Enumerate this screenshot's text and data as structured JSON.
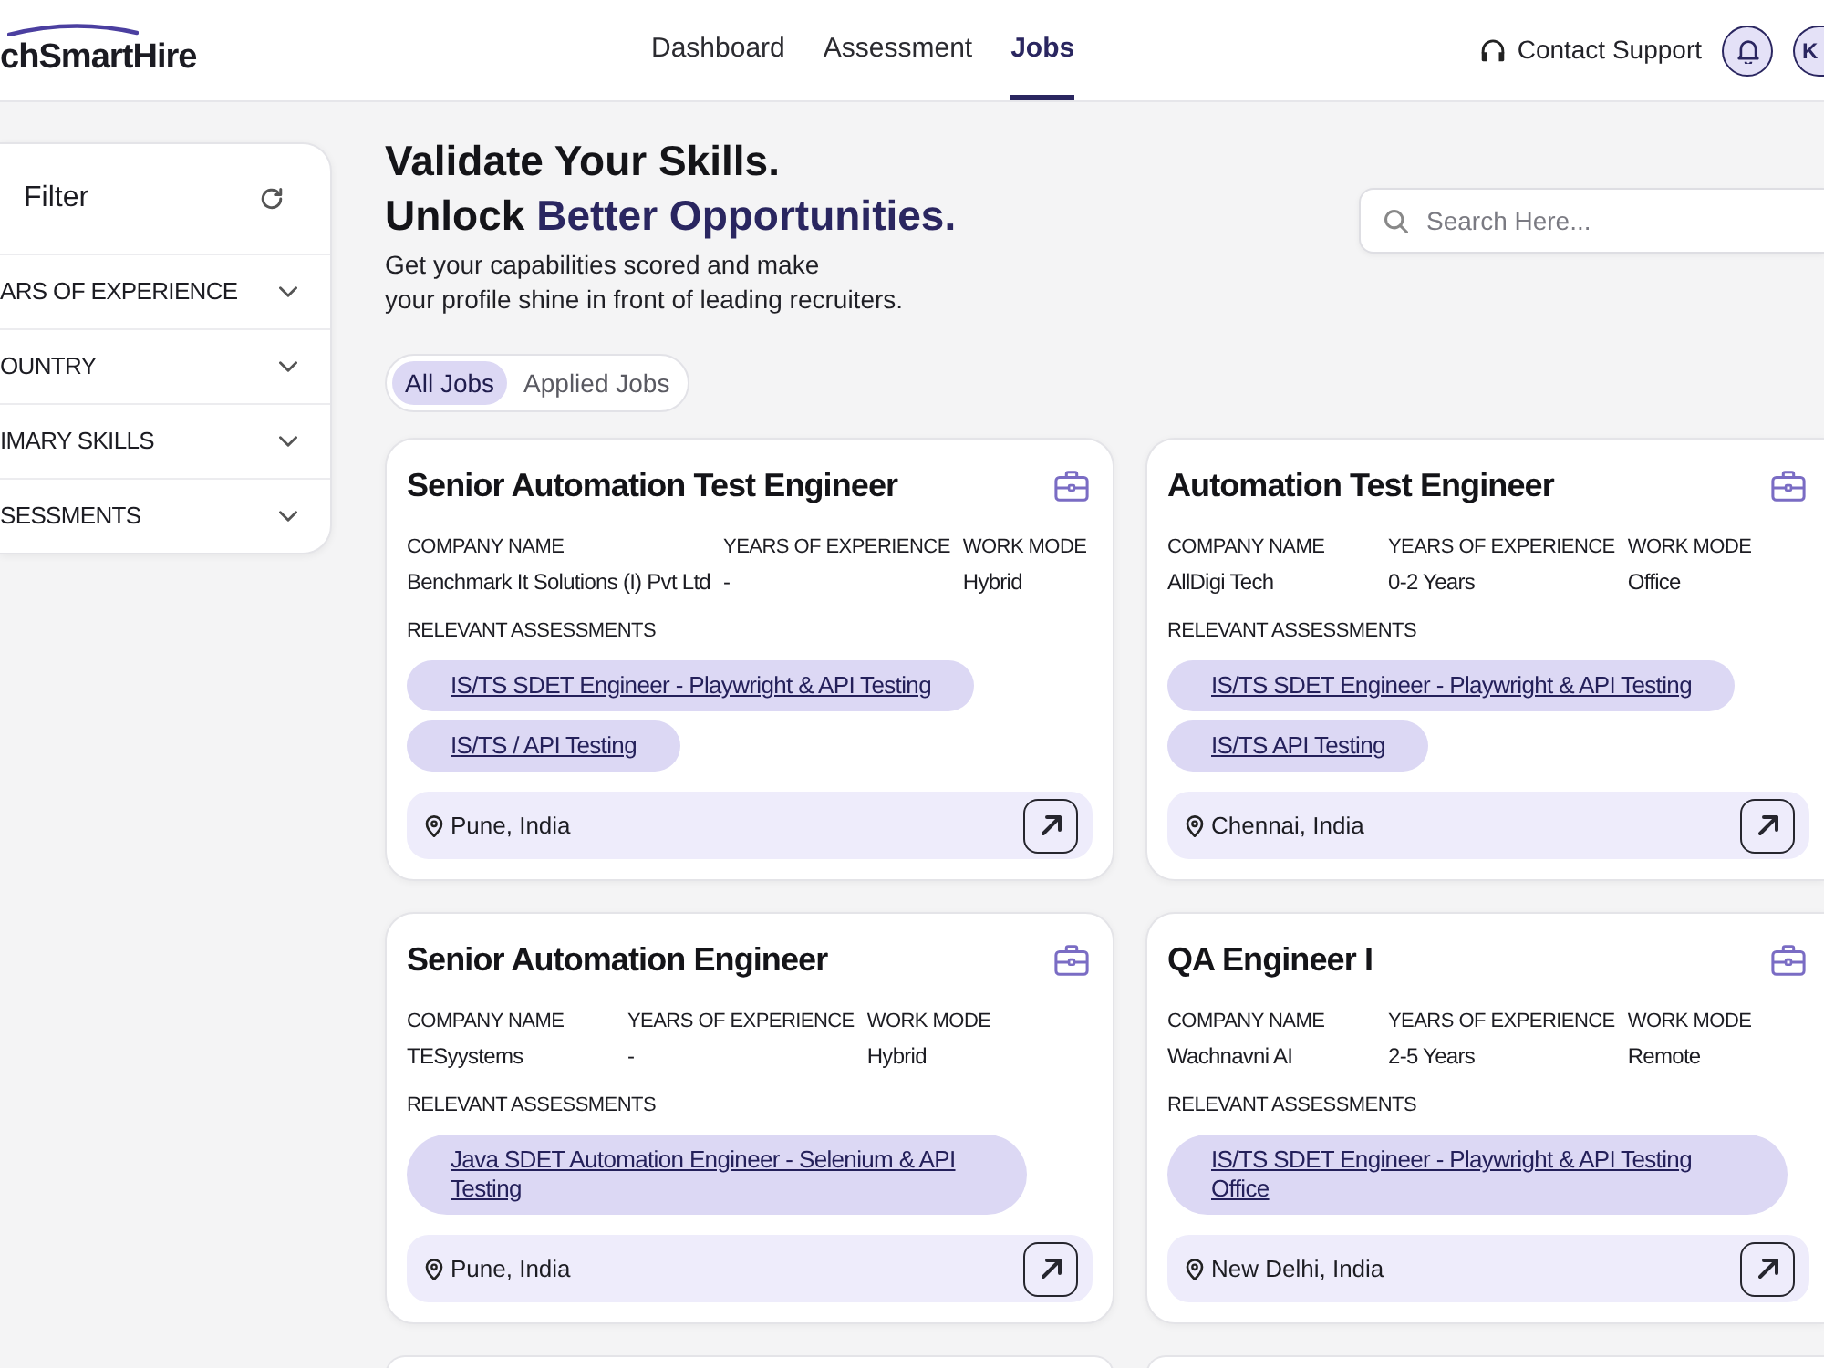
{
  "header": {
    "logo": "chSmartHire",
    "nav": [
      {
        "label": "Dashboard",
        "selected": false
      },
      {
        "label": "Assessment",
        "selected": false
      },
      {
        "label": "Jobs",
        "selected": true
      }
    ],
    "contact_support": "Contact Support",
    "avatar_initials": "K"
  },
  "filter": {
    "title": "Filter",
    "sections": [
      {
        "label": "ARS OF EXPERIENCE",
        "expanded": false
      },
      {
        "label": "OUNTRY",
        "expanded": false
      },
      {
        "label": "IMARY SKILLS",
        "expanded": false
      },
      {
        "label": "SESSMENTS",
        "expanded": false
      }
    ]
  },
  "hero": {
    "heading_line_1": "Validate Your Skills.",
    "heading_line_2": "Unlock",
    "heading_highlight": "Better Opportunities.",
    "subtitle_lines": [
      "Get your capabilities scored and make",
      "your profile shine in front of leading recruiters."
    ]
  },
  "search": {
    "placeholder": "Search Here..."
  },
  "job_tabs": [
    {
      "label": "All Jobs",
      "selected": true
    },
    {
      "label": "Applied Jobs",
      "selected": false
    }
  ],
  "jobs": [
    {
      "title": "Senior Automation Test Engineer",
      "fields": [
        {
          "label": "COMPANY NAME",
          "value": "Benchmark It Solutions (I) Pvt Ltd"
        },
        {
          "label": "YEARS OF EXPERIENCE",
          "value": "-"
        },
        {
          "label": "WORK MODE",
          "value": "Hybrid"
        }
      ],
      "assessments_label": "RELEVANT ASSESSMENTS",
      "assessments": [
        "IS/TS SDET Engineer - Playwright & API Testing",
        "IS/TS / API Testing"
      ],
      "location": "Pune, India"
    },
    {
      "title": "Automation Test Engineer",
      "fields": [
        {
          "label": "COMPANY NAME",
          "value": "AllDigi Tech"
        },
        {
          "label": "YEARS OF EXPERIENCE",
          "value": "0-2 Years"
        },
        {
          "label": "WORK MODE",
          "value": "Office"
        }
      ],
      "assessments_label": "RELEVANT ASSESSMENTS",
      "assessments": [
        "IS/TS SDET Engineer - Playwright & API Testing",
        "IS/TS API Testing"
      ],
      "location": "Chennai, India"
    },
    {
      "title": "Senior Automation Engineer",
      "fields": [
        {
          "label": "COMPANY NAME",
          "value": "TESyystems"
        },
        {
          "label": "YEARS OF EXPERIENCE",
          "value": "-"
        },
        {
          "label": "WORK MODE",
          "value": "Hybrid"
        }
      ],
      "assessments_label": "RELEVANT ASSESSMENTS",
      "assessments": [
        "Java SDET Automation Engineer - Selenium & API Testing"
      ],
      "location": "Pune, India"
    },
    {
      "title": "QA Engineer I",
      "fields": [
        {
          "label": "COMPANY NAME",
          "value": "Wachnavni AI"
        },
        {
          "label": "YEARS OF EXPERIENCE",
          "value": "2-5 Years"
        },
        {
          "label": "WORK MODE",
          "value": "Remote"
        }
      ],
      "assessments_label": "RELEVANT ASSESSMENTS",
      "assessments": [
        "IS/TS SDET Engineer - Playwright & API Testing Office"
      ],
      "location": "New Delhi, India"
    }
  ]
}
